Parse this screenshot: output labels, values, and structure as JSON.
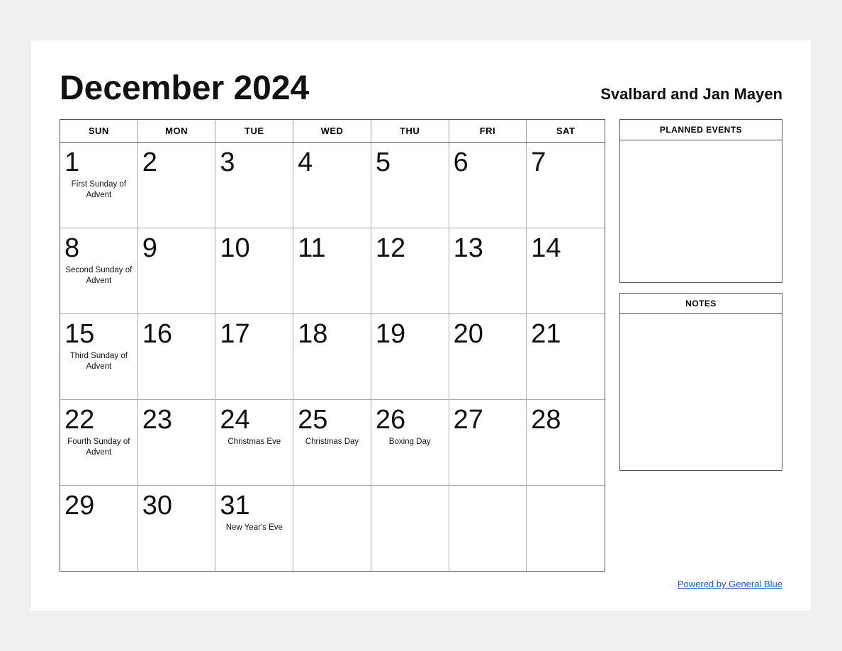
{
  "header": {
    "title": "December 2024",
    "region": "Svalbard and Jan Mayen"
  },
  "calendar": {
    "days_of_week": [
      "SUN",
      "MON",
      "TUE",
      "WED",
      "THU",
      "FRI",
      "SAT"
    ],
    "rows": [
      [
        {
          "num": "1",
          "event": "First Sunday of Advent"
        },
        {
          "num": "2",
          "event": ""
        },
        {
          "num": "3",
          "event": ""
        },
        {
          "num": "4",
          "event": ""
        },
        {
          "num": "5",
          "event": ""
        },
        {
          "num": "6",
          "event": ""
        },
        {
          "num": "7",
          "event": ""
        }
      ],
      [
        {
          "num": "8",
          "event": "Second Sunday of Advent"
        },
        {
          "num": "9",
          "event": ""
        },
        {
          "num": "10",
          "event": ""
        },
        {
          "num": "11",
          "event": ""
        },
        {
          "num": "12",
          "event": ""
        },
        {
          "num": "13",
          "event": ""
        },
        {
          "num": "14",
          "event": ""
        }
      ],
      [
        {
          "num": "15",
          "event": "Third Sunday of Advent"
        },
        {
          "num": "16",
          "event": ""
        },
        {
          "num": "17",
          "event": ""
        },
        {
          "num": "18",
          "event": ""
        },
        {
          "num": "19",
          "event": ""
        },
        {
          "num": "20",
          "event": ""
        },
        {
          "num": "21",
          "event": ""
        }
      ],
      [
        {
          "num": "22",
          "event": "Fourth Sunday of Advent"
        },
        {
          "num": "23",
          "event": ""
        },
        {
          "num": "24",
          "event": "Christmas Eve"
        },
        {
          "num": "25",
          "event": "Christmas Day"
        },
        {
          "num": "26",
          "event": "Boxing Day"
        },
        {
          "num": "27",
          "event": ""
        },
        {
          "num": "28",
          "event": ""
        }
      ],
      [
        {
          "num": "29",
          "event": ""
        },
        {
          "num": "30",
          "event": ""
        },
        {
          "num": "31",
          "event": "New Year's Eve"
        },
        {
          "num": "",
          "event": ""
        },
        {
          "num": "",
          "event": ""
        },
        {
          "num": "",
          "event": ""
        },
        {
          "num": "",
          "event": ""
        }
      ]
    ]
  },
  "sidebar": {
    "planned_events_label": "PLANNED EVENTS",
    "notes_label": "NOTES"
  },
  "footer": {
    "powered_text": "Powered by General Blue",
    "powered_url": "#"
  }
}
